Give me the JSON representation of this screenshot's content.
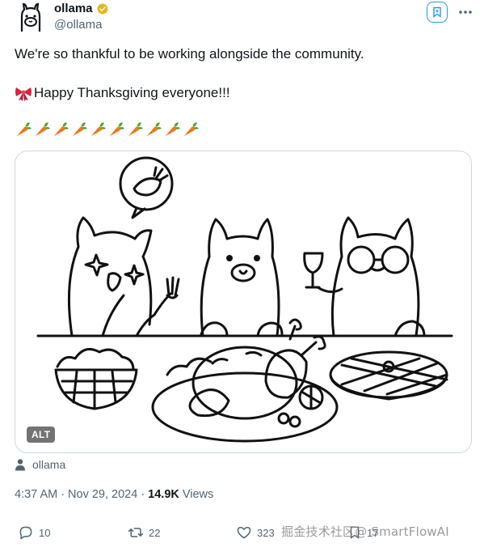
{
  "author": {
    "display_name": "ollama",
    "handle": "@ollama"
  },
  "tweet": {
    "line1": "We're so thankful to be working alongside the community.",
    "line2": "Happy Thanksgiving everyone!!!",
    "carrot_count": 10
  },
  "media": {
    "alt_label": "ALT"
  },
  "credit": {
    "name": "ollama"
  },
  "meta": {
    "time": "4:37 AM",
    "separator": "·",
    "date": "Nov 29, 2024",
    "views_count": "14.9K",
    "views_label": "Views"
  },
  "actions": {
    "replies": "10",
    "reposts": "22",
    "likes": "323",
    "bookmarks": "17"
  },
  "watermark": "掘金技术社区@ SmartFlowAI",
  "icons": {
    "verified": "verified-gold-icon",
    "ribbon": "ribbon-emoji-icon",
    "carrot": "carrot-emoji-icon",
    "grok": "grok-icon",
    "more": "more-dots-icon",
    "person": "person-icon",
    "reply": "reply-icon",
    "repost": "repost-icon",
    "like": "heart-icon",
    "bookmark": "bookmark-icon"
  },
  "colors": {
    "accent": "#1d9bf0",
    "muted": "#536471",
    "verified_gold": "#e2b719",
    "carrot": "#f07a1a",
    "ribbon": "#d6253e"
  }
}
